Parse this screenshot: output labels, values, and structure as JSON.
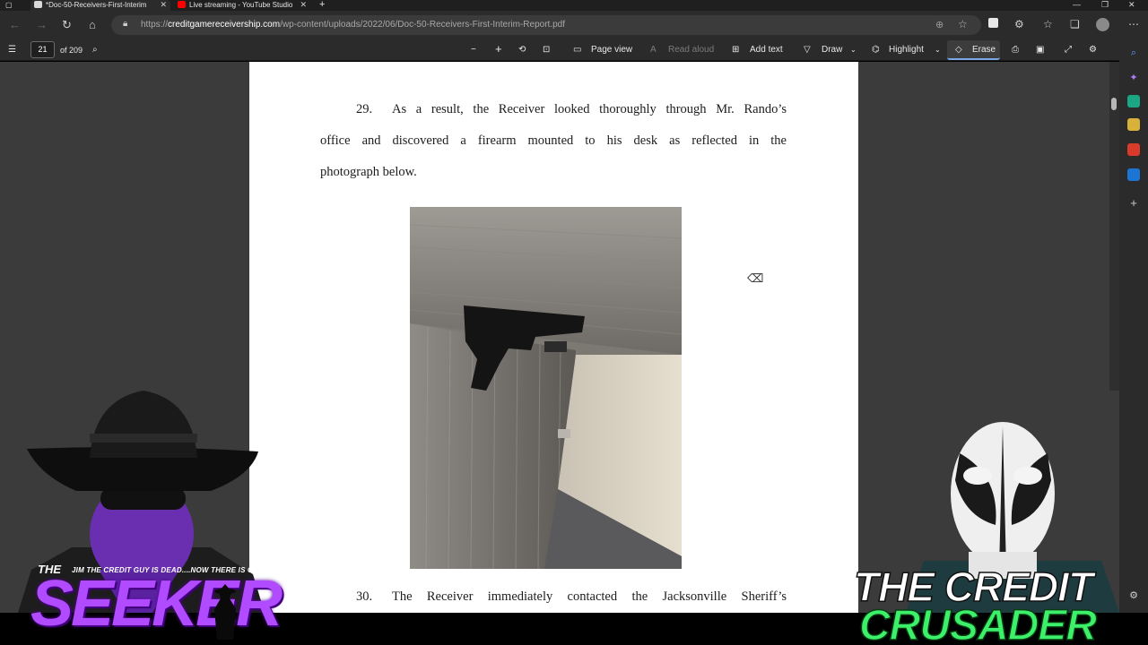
{
  "browser": {
    "tabs": [
      {
        "title": "*Doc-50-Receivers-First-Interim",
        "active": true
      },
      {
        "title": "Live streaming - YouTube Studio",
        "active": false
      }
    ],
    "new_tab_label": "+",
    "url_prefix": "https://",
    "url_domain": "creditgamereceivership.com",
    "url_path": "/wp-content/uploads/2022/06/Doc-50-Receivers-First-Interim-Report.pdf"
  },
  "pdf_toolbar": {
    "current_page": "21",
    "page_count": "of 209",
    "page_view_label": "Page view",
    "read_aloud_label": "Read aloud",
    "add_text_label": "Add text",
    "draw_label": "Draw",
    "highlight_label": "Highlight",
    "erase_label": "Erase"
  },
  "document": {
    "para29_num": "29.",
    "para29_line1": "As a result, the Receiver looked thoroughly through Mr. Rando’s",
    "para29_line2": "office and discovered a firearm mounted to his desk as reflected in the",
    "para29_line3": "photograph below.",
    "para30_num": "30.",
    "para30_line1": "The Receiver immediately contacted the Jacksonville Sheriff’s"
  },
  "overlays": {
    "seeker_the": "THE",
    "seeker_tagline": "JIM THE CREDIT GUY IS DEAD....NOW THERE IS ONLY",
    "seeker_name": "SEEKER",
    "crusader_line1": "THE CREDIT",
    "crusader_line2": "CRUSADER"
  },
  "colors": {
    "seeker_purple": "#b14bff",
    "crusader_green": "#3cf06a",
    "accent_blue": "#7aa7e8"
  }
}
